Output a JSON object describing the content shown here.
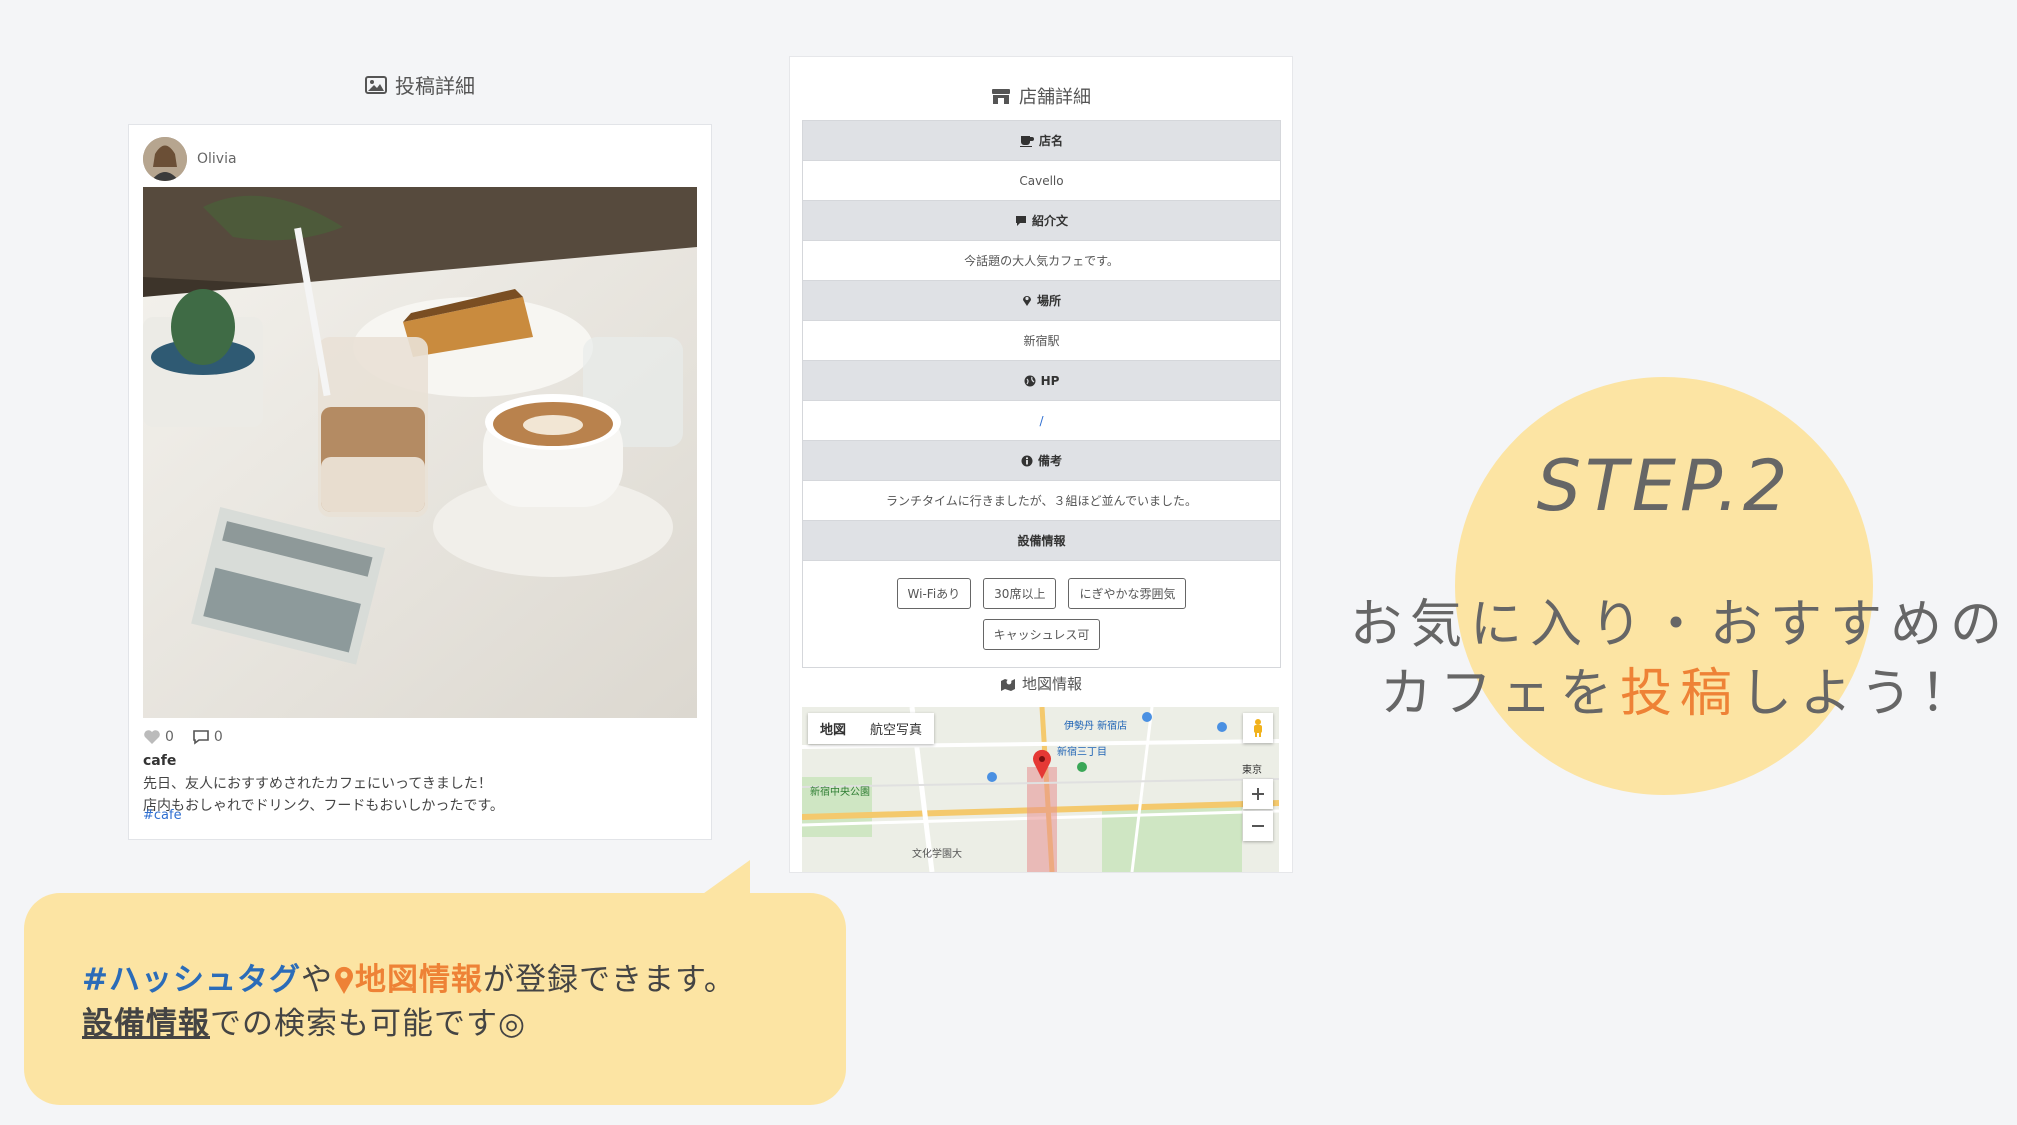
{
  "post": {
    "heading": "投稿詳細",
    "username": "Olivia",
    "likes": "0",
    "comments": "0",
    "title": "cafe",
    "body_line1": "先日、友人におすすめされたカフェにいってきました！",
    "body_line2": "店内もおしゃれでドリンク、フードもおいしかったです。",
    "hashtag": "#cafe"
  },
  "shop": {
    "heading": "店舗詳細",
    "name_label": "店名",
    "name_value": "Cavello",
    "intro_label": "紹介文",
    "intro_value": "今話題の大人気カフェです。",
    "place_label": "場所",
    "place_value": "新宿駅",
    "hp_label": "HP",
    "hp_value": "/",
    "note_label": "備考",
    "note_value": "ランチタイムに行きましたが、３組ほど並んでいました。",
    "facility_label": "設備情報",
    "facilities": [
      "Wi-Fiあり",
      "30席以上",
      "にぎやかな雰囲気",
      "キャッシュレス可"
    ],
    "map_heading": "地図情報",
    "map_tab_map": "地図",
    "map_tab_aerial": "航空写真",
    "map_labels": [
      "伊勢丹 新宿店",
      "新宿三丁目",
      "新宿中央公園",
      "文化学園大",
      "東京"
    ]
  },
  "promo": {
    "step": "STEP.2",
    "tagline_line1": "お気に入り・おすすめの",
    "tagline_line2_pre": "カフェを",
    "tagline_line2_em": "投稿",
    "tagline_line2_post": "しよう！",
    "bubble_hash": "#ハッシュタグ",
    "bubble_ya": "や",
    "bubble_map": "地図情報",
    "bubble_rest1": "が登録できます。",
    "bubble_under": "設備情報",
    "bubble_rest2": "での検索も可能です◎"
  },
  "colors": {
    "accent_orange": "#ee8236",
    "accent_blue": "#2b6cb8",
    "bubble_yellow": "#fce4a3"
  }
}
